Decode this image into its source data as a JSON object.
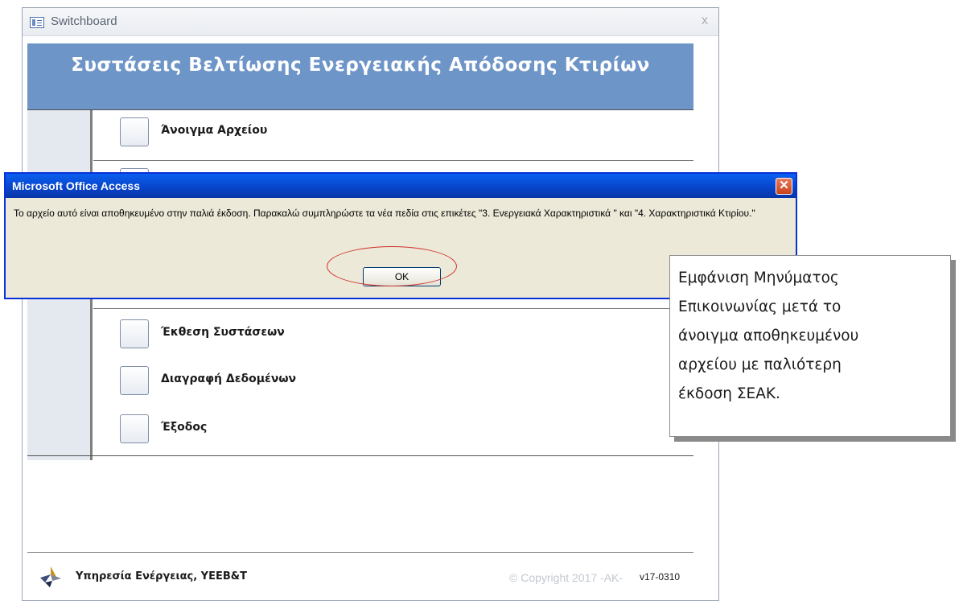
{
  "switchboard": {
    "window_title": "Switchboard",
    "close_glyph": "x",
    "header_title": "Συστάσεις Βελτίωσης Ενεργειακής Απόδοσης Κτιρίων",
    "items": [
      {
        "label": "Άνοιγμα Αρχείου"
      },
      {
        "label": "Έκθεση Συστάσεων"
      },
      {
        "label": "Διαγραφή Δεδομένων"
      },
      {
        "label": "Έξοδος"
      }
    ],
    "footer": {
      "organization": "Υπηρεσία Ενέργειας, ΥΕΕΒ&Τ",
      "copyright": "© Copyright 2017 -AK-",
      "version": "v17-0310"
    }
  },
  "dialog": {
    "title": "Microsoft Office Access",
    "close_glyph": "✕",
    "message": "Το αρχείο αυτό είναι αποθηκευμένο στην παλιά έκδοση. Παρακαλώ συμπληρώστε τα νέα πεδία στις επικέτες \"3. Ενεργειακά Χαρακτηριστικά \" και \"4. Χαρακτηριστικά Κτιρίου.\"",
    "ok_label": "OK"
  },
  "callout": {
    "text": "Εμφάνιση  Μηνύματος\nΕπικοινωνίας μετά το\nάνοιγμα αποθηκευμένου\nαρχείου με παλιότερη\nέκδοση ΣΕΑΚ."
  },
  "colors": {
    "header_bg": "#6e95c8",
    "dialog_titlebar": "#0844c8",
    "highlight_ellipse": "#d0312d"
  }
}
